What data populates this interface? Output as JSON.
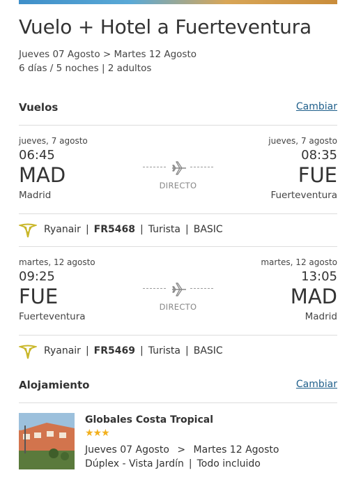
{
  "header": {
    "title": "Vuelo + Hotel a Fuerteventura",
    "dates": "Jueves 07 Agosto > Martes 12 Agosto",
    "summary": "6 días / 5 noches | 2 adultos"
  },
  "flights_section": {
    "title": "Vuelos",
    "change_label": "Cambiar"
  },
  "flights": [
    {
      "dep_date": "jueves, 7 agosto",
      "dep_time": "06:45",
      "dep_code": "MAD",
      "dep_city": "Madrid",
      "arr_date": "jueves, 7 agosto",
      "arr_time": "08:35",
      "arr_code": "FUE",
      "arr_city": "Fuerteventura",
      "stops_label": "DIRECTO",
      "airline": "Ryanair",
      "flight_number": "FR5468",
      "cabin": "Turista",
      "fare": "BASIC"
    },
    {
      "dep_date": "martes, 12 agosto",
      "dep_time": "09:25",
      "dep_code": "FUE",
      "dep_city": "Fuerteventura",
      "arr_date": "martes, 12 agosto",
      "arr_time": "13:05",
      "arr_code": "MAD",
      "arr_city": "Madrid",
      "stops_label": "DIRECTO",
      "airline": "Ryanair",
      "flight_number": "FR5469",
      "cabin": "Turista",
      "fare": "BASIC"
    }
  ],
  "separator": "|",
  "accommodation_section": {
    "title": "Alojamiento",
    "change_label": "Cambiar"
  },
  "hotel": {
    "name": "Globales Costa Tropical",
    "stars": 3,
    "stars_display": "★★★",
    "check_in": "Jueves 07 Agosto",
    "arrow": ">",
    "check_out": "Martes 12 Agosto",
    "room": "Dúplex - Vista Jardín",
    "board": "Todo incluido"
  },
  "colors": {
    "link": "#1f5f8b",
    "star": "#f2b01e",
    "ryanair_logo": "#c9b72a",
    "divider": "#dddddd"
  },
  "icons": {
    "plane": "plane-icon",
    "airline_logo": "ryanair-logo-icon"
  }
}
